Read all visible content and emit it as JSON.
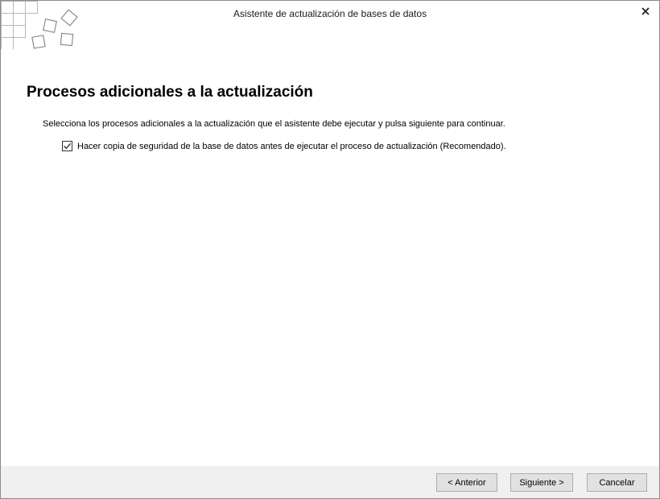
{
  "window": {
    "title": "Asistente de actualización de bases de datos",
    "close_icon": "close-icon"
  },
  "page": {
    "heading": "Procesos adicionales a la actualización",
    "description": "Selecciona los procesos adicionales a la actualización que el asistente debe ejecutar y pulsa siguiente para continuar.",
    "options": [
      {
        "label": "Hacer copia de seguridad de la base de datos antes de ejecutar el proceso de actualización (Recomendado).",
        "checked": true
      }
    ]
  },
  "footer": {
    "prev_label": "< Anterior",
    "next_label": "Siguiente >",
    "cancel_label": "Cancelar"
  }
}
